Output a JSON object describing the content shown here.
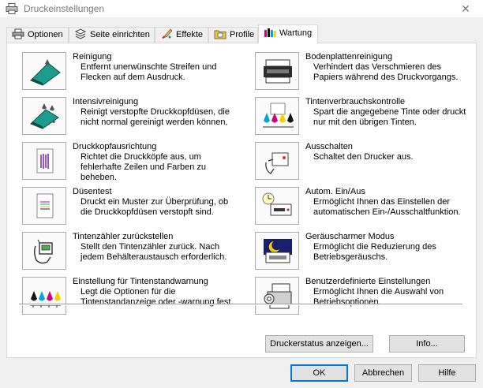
{
  "window": {
    "title": "Druckeinstellungen",
    "close_glyph": "✕"
  },
  "tabs": [
    {
      "label": "Optionen",
      "icon": "printer-icon"
    },
    {
      "label": "Seite einrichten",
      "icon": "pages-icon"
    },
    {
      "label": "Effekte",
      "icon": "brush-icon"
    },
    {
      "label": "Profile",
      "icon": "folder-icon"
    },
    {
      "label": "Wartung",
      "icon": "ink-icon",
      "active": true
    }
  ],
  "left_items": [
    {
      "title": "Reinigung",
      "desc": "Entfernt unerwünschte Streifen und Flecken auf dem Ausdruck.",
      "icon": "cleaning-icon"
    },
    {
      "title": "Intensivreinigung",
      "desc": "Reinigt verstopfte Druckkopfdüsen, die nicht normal gereinigt werden können.",
      "icon": "deep-cleaning-icon"
    },
    {
      "title": "Druckkopfausrichtung",
      "desc": "Richtet die Druckköpfe aus, um fehlerhafte Zeilen und Farben zu beheben.",
      "icon": "print-head-alignment-icon"
    },
    {
      "title": "Düsentest",
      "desc": "Druckt ein Muster zur Überprüfung, ob die Druckkopfdüsen verstopft sind.",
      "icon": "nozzle-check-icon"
    },
    {
      "title": "Tintenzähler zurückstellen",
      "desc": "Stellt den Tintenzähler zurück. Nach jedem Behälteraustausch erforderlich.",
      "icon": "ink-counter-reset-icon"
    },
    {
      "title": "Einstellung für Tintenstandwarnung",
      "desc": "Legt die Optionen für die Tintenstandanzeige oder -warnung fest.",
      "icon": "ink-level-warning-icon"
    }
  ],
  "right_items": [
    {
      "title": "Bodenplattenreinigung",
      "desc": "Verhindert das Verschmieren des Papiers während des Druckvorgangs.",
      "icon": "bottom-plate-cleaning-icon"
    },
    {
      "title": "Tintenverbrauchskontrolle",
      "desc": "Spart die angegebene Tinte oder druckt nur mit den übrigen Tinten.",
      "icon": "ink-usage-icon"
    },
    {
      "title": "Ausschalten",
      "desc": "Schaltet den Drucker aus.",
      "icon": "power-off-icon"
    },
    {
      "title": "Autom. Ein/Aus",
      "desc": "Ermöglicht Ihnen das Einstellen der automatischen Ein-/Ausschaltfunktion.",
      "icon": "auto-power-icon"
    },
    {
      "title": "Geräuscharmer Modus",
      "desc": "Ermöglicht die Reduzierung des Betriebsgeräuschs.",
      "icon": "quiet-mode-icon"
    },
    {
      "title": "Benutzerdefinierte Einstellungen",
      "desc": "Ermöglicht Ihnen die Auswahl von Betriebsoptionen.",
      "icon": "custom-settings-icon"
    }
  ],
  "panel_buttons": {
    "status": "Druckerstatus anzeigen...",
    "info": "Info..."
  },
  "dialog_buttons": {
    "ok": "OK",
    "cancel": "Abbrechen",
    "help": "Hilfe"
  }
}
